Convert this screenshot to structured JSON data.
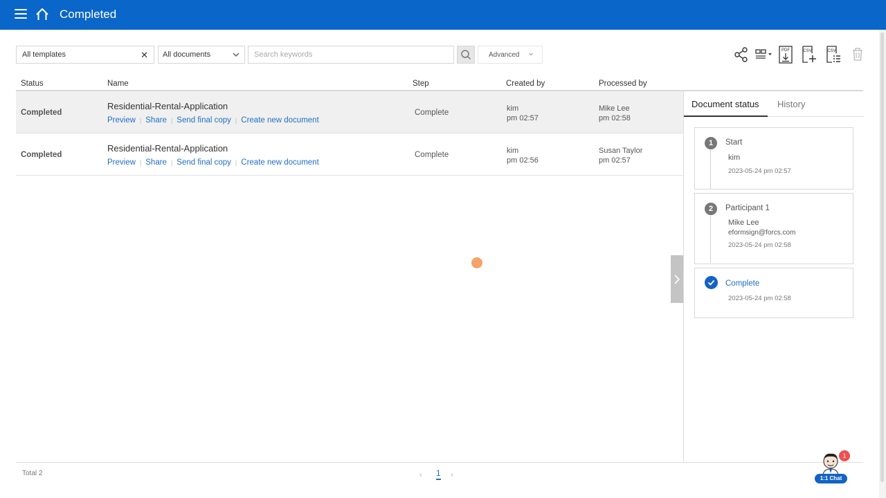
{
  "header": {
    "title": "Completed"
  },
  "filters": {
    "templates_value": "All templates",
    "documents_value": "All documents",
    "search_placeholder": "Search keywords",
    "advanced_label": "Advanced"
  },
  "toolbar": {
    "icons": [
      "share-icon",
      "layout-toggle-icon",
      "pdf-download-icon",
      "csv-add-icon",
      "csv-list-icon",
      "trash-icon"
    ],
    "pdf_text": "PDF",
    "csv_text": "CSV"
  },
  "table": {
    "columns": {
      "status": "Status",
      "name": "Name",
      "step": "Step",
      "created_by": "Created by",
      "processed_by": "Processed by"
    },
    "link_labels": {
      "preview": "Preview",
      "share": "Share",
      "send_final_copy": "Send final copy",
      "create_new_document": "Create new document"
    },
    "rows": [
      {
        "status": "Completed",
        "name": "Residential-Rental-Application",
        "step": "Complete",
        "created_by": "kim",
        "created_time": "pm 02:57",
        "processed_by": "Mike Lee",
        "processed_time": "pm 02:58"
      },
      {
        "status": "Completed",
        "name": "Residential-Rental-Application",
        "step": "Complete",
        "created_by": "kim",
        "created_time": "pm 02:56",
        "processed_by": "Susan Taylor",
        "processed_time": "pm 02:57"
      }
    ]
  },
  "panel": {
    "tabs": {
      "status": "Document status",
      "history": "History"
    },
    "steps": [
      {
        "number": "1",
        "title": "Start",
        "name": "kim",
        "date": "2023-05-24 pm 02:57"
      },
      {
        "number": "2",
        "title": "Participant 1",
        "name": "Mike Lee",
        "email": "eformsign@forcs.com",
        "date": "2023-05-24 pm 02:58"
      },
      {
        "title": "Complete",
        "date": "2023-05-24 pm 02:58"
      }
    ]
  },
  "footer": {
    "total": "Total 2",
    "current_page": "1"
  },
  "chat": {
    "label": "1:1 Chat",
    "badge": "1"
  },
  "colors": {
    "header_bg": "#0a66c8",
    "link": "#1f6fc8",
    "badge": "#ef4f4f"
  }
}
